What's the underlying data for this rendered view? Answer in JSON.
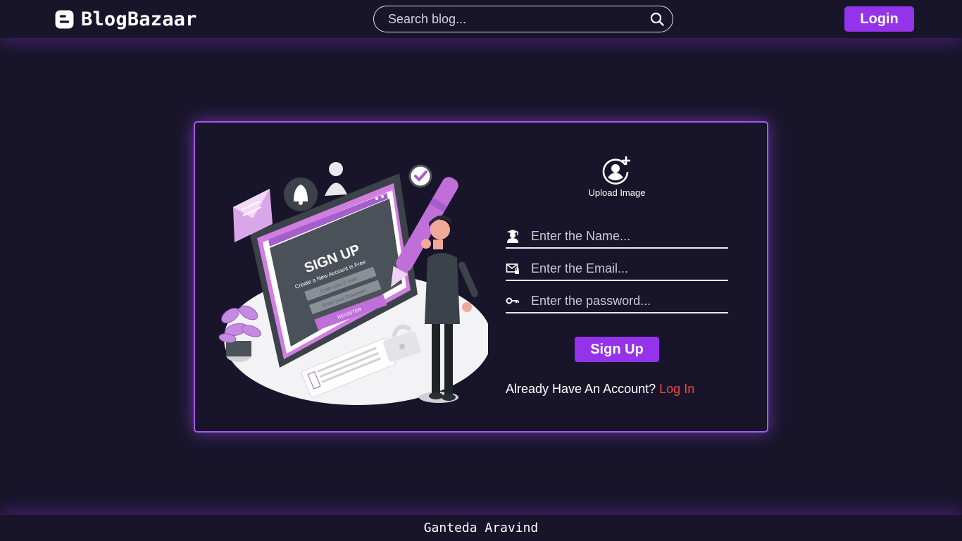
{
  "header": {
    "brand_icon": "blogger-icon",
    "brand_name": "BlogBazaar",
    "search_placeholder": "Search blog...",
    "search_icon": "search-icon",
    "login_label": "Login"
  },
  "illustration": {
    "signup_title": "SIGN UP",
    "signup_subtitle": "Create a New Account is Free",
    "email_field": "Enter your E-mail",
    "password_field": "Enter your Password",
    "register_button": "REGISTER"
  },
  "form": {
    "upload_icon": "add-user-icon",
    "upload_label": "Upload Image",
    "name_placeholder": "Enter the Name...",
    "email_placeholder": "Enter the Email...",
    "password_placeholder": "Enter the password...",
    "signup_label": "Sign Up",
    "account_text": "Already Have An Account?",
    "login_link": "Log In"
  },
  "footer": {
    "author": "Ganteda Aravind"
  },
  "colors": {
    "background": "#18152a",
    "accent": "#9333ea",
    "card_border": "#a855f7",
    "link": "#ef4444"
  }
}
